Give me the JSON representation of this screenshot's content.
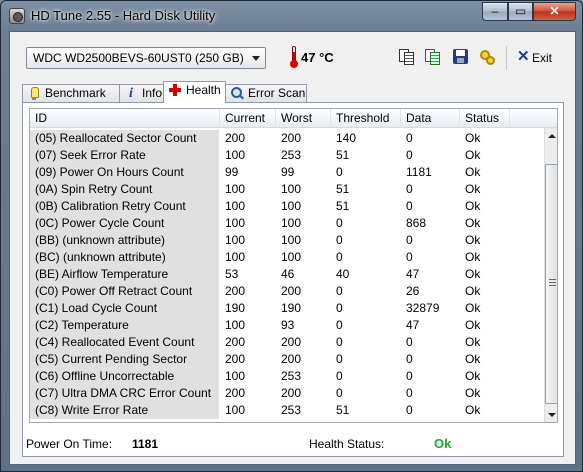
{
  "window": {
    "title": "HD Tune 2.55 - Hard Disk Utility",
    "minimize_glyph": "–",
    "maximize_glyph": "▭",
    "close_glyph": "✕"
  },
  "toolbar": {
    "drive": "WDC WD2500BEVS-60UST0 (250 GB)",
    "temperature": "47 °C",
    "exit_label": "Exit",
    "icons": [
      "thermometer-icon",
      "copy-icon",
      "copy-all-icon",
      "save-icon",
      "options-icon",
      "exit-icon"
    ]
  },
  "tabs": [
    {
      "label": "Benchmark",
      "icon": "bulb-icon"
    },
    {
      "label": "Info",
      "icon": "info-icon"
    },
    {
      "label": "Health",
      "icon": "red-cross-icon",
      "active": true
    },
    {
      "label": "Error Scan",
      "icon": "magnifier-icon"
    }
  ],
  "table": {
    "columns": [
      "ID",
      "Current",
      "Worst",
      "Threshold",
      "Data",
      "Status"
    ],
    "rows": [
      [
        "(05) Reallocated Sector Count",
        "200",
        "200",
        "140",
        "0",
        "Ok"
      ],
      [
        "(07) Seek Error Rate",
        "100",
        "253",
        "51",
        "0",
        "Ok"
      ],
      [
        "(09) Power On Hours Count",
        "99",
        "99",
        "0",
        "1181",
        "Ok"
      ],
      [
        "(0A) Spin Retry Count",
        "100",
        "100",
        "51",
        "0",
        "Ok"
      ],
      [
        "(0B) Calibration Retry Count",
        "100",
        "100",
        "51",
        "0",
        "Ok"
      ],
      [
        "(0C) Power Cycle Count",
        "100",
        "100",
        "0",
        "868",
        "Ok"
      ],
      [
        "(BB) (unknown attribute)",
        "100",
        "100",
        "0",
        "0",
        "Ok"
      ],
      [
        "(BC) (unknown attribute)",
        "100",
        "100",
        "0",
        "0",
        "Ok"
      ],
      [
        "(BE) Airflow Temperature",
        "53",
        "46",
        "40",
        "47",
        "Ok"
      ],
      [
        "(C0) Power Off Retract Count",
        "200",
        "200",
        "0",
        "26",
        "Ok"
      ],
      [
        "(C1) Load Cycle Count",
        "190",
        "190",
        "0",
        "32879",
        "Ok"
      ],
      [
        "(C2) Temperature",
        "100",
        "93",
        "0",
        "47",
        "Ok"
      ],
      [
        "(C4) Reallocated Event Count",
        "200",
        "200",
        "0",
        "0",
        "Ok"
      ],
      [
        "(C5) Current Pending Sector",
        "200",
        "200",
        "0",
        "0",
        "Ok"
      ],
      [
        "(C6) Offline Uncorrectable",
        "100",
        "253",
        "0",
        "0",
        "Ok"
      ],
      [
        "(C7) Ultra DMA CRC Error Count",
        "200",
        "200",
        "0",
        "0",
        "Ok"
      ],
      [
        "(C8) Write Error Rate",
        "100",
        "253",
        "51",
        "0",
        "Ok"
      ]
    ]
  },
  "footer": {
    "power_on_time_label": "Power On Time:",
    "power_on_time_value": "1181",
    "health_status_label": "Health Status:",
    "health_status_value": "Ok"
  },
  "colors": {
    "ok_green": "#22aa22",
    "id_column_bg": "#e0e0e0",
    "titlebar": "#7d8fa3"
  }
}
